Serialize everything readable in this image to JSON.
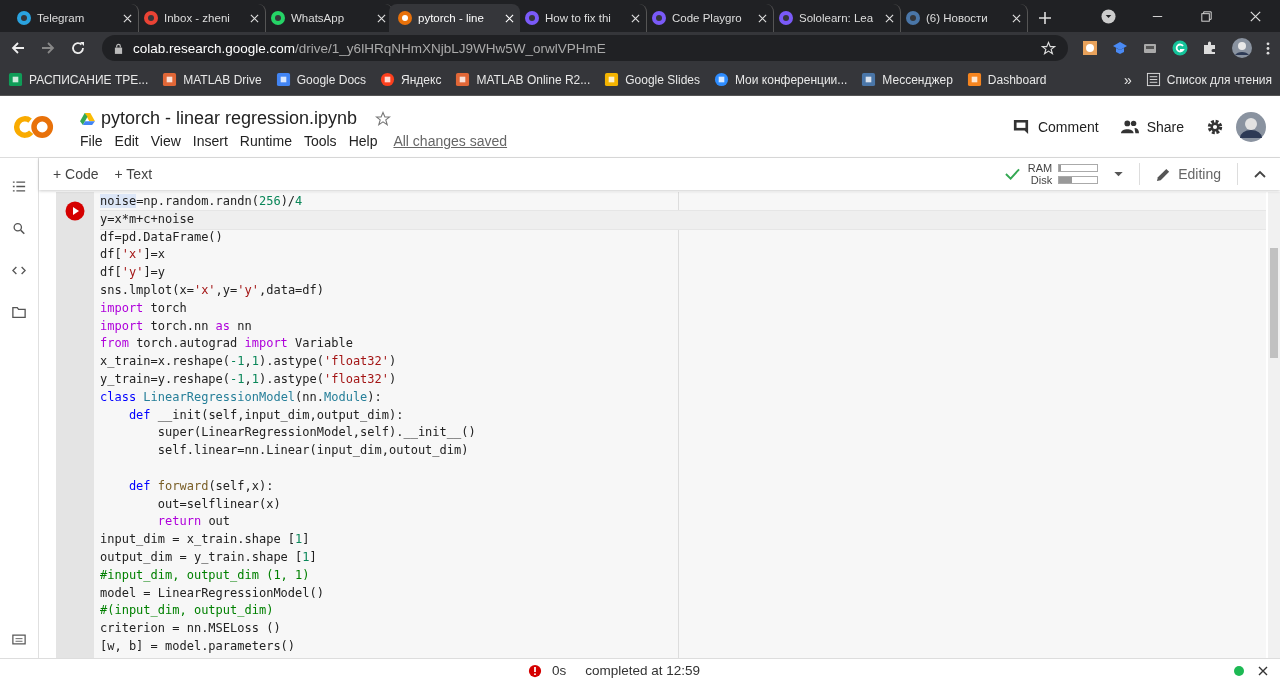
{
  "browser": {
    "tabs": [
      {
        "title": "Telegram",
        "selected": false
      },
      {
        "title": "Inbox - zheni",
        "selected": false
      },
      {
        "title": "WhatsApp",
        "selected": false
      },
      {
        "title": "pytorch - line",
        "selected": true
      },
      {
        "title": "How to fix thi",
        "selected": false
      },
      {
        "title": "Code Playgro",
        "selected": false
      },
      {
        "title": "Sololearn: Lea",
        "selected": false
      },
      {
        "title": "(6) Новости",
        "selected": false
      }
    ],
    "url_host": "colab.research.google.com",
    "url_path": "/drive/1_y6lHRqNHmXNjbLJ9WHw5W_orwlVPHmE",
    "bookmarks": [
      {
        "label": "РАСПИСАНИЕ ТРЕ..."
      },
      {
        "label": "MATLAB Drive"
      },
      {
        "label": "Google Docs"
      },
      {
        "label": "Яндекс"
      },
      {
        "label": "MATLAB Online R2..."
      },
      {
        "label": "Google Slides"
      },
      {
        "label": "Мои конференции..."
      },
      {
        "label": "Мессенджер"
      },
      {
        "label": "Dashboard"
      }
    ],
    "more": "»",
    "reading_list": "Список для чтения"
  },
  "notebook": {
    "title": "pytorch - linear regression.ipynb",
    "menu": [
      "File",
      "Edit",
      "View",
      "Insert",
      "Runtime",
      "Tools",
      "Help"
    ],
    "save_status": "All changes saved",
    "comment": "Comment",
    "share": "Share",
    "add_code": "+ Code",
    "add_text": "+ Text",
    "ram_label": "RAM",
    "ram": {
      "level": 0.05
    },
    "disk_label": "Disk",
    "disk": {
      "level": 0.35
    },
    "mode": "Editing"
  },
  "cell": {
    "lines": [
      {
        "current": false,
        "tokens": [
          {
            "kind": "match",
            "text": "noise"
          },
          {
            "kind": "plain",
            "text": "=np.random.randn("
          },
          {
            "kind": "num",
            "text": "256"
          },
          {
            "kind": "plain",
            "text": ")/"
          },
          {
            "kind": "num",
            "text": "4"
          }
        ]
      },
      {
        "current": true,
        "tokens": [
          {
            "kind": "plain",
            "text": "y=x*m+c+noise"
          }
        ]
      },
      {
        "current": false,
        "tokens": [
          {
            "kind": "plain",
            "text": "df=pd.DataFrame()"
          }
        ]
      },
      {
        "current": false,
        "tokens": [
          {
            "kind": "plain",
            "text": "df["
          },
          {
            "kind": "str",
            "text": "'x'"
          },
          {
            "kind": "plain",
            "text": "]=x"
          }
        ]
      },
      {
        "current": false,
        "tokens": [
          {
            "kind": "plain",
            "text": "df["
          },
          {
            "kind": "str",
            "text": "'y'"
          },
          {
            "kind": "plain",
            "text": "]=y"
          }
        ]
      },
      {
        "current": false,
        "tokens": [
          {
            "kind": "plain",
            "text": "sns.lmplot(x="
          },
          {
            "kind": "str",
            "text": "'x'"
          },
          {
            "kind": "plain",
            "text": ",y="
          },
          {
            "kind": "str",
            "text": "'y'"
          },
          {
            "kind": "plain",
            "text": ",data=df)"
          }
        ]
      },
      {
        "current": false,
        "tokens": [
          {
            "kind": "kw",
            "text": "import"
          },
          {
            "kind": "plain",
            "text": " torch"
          }
        ]
      },
      {
        "current": false,
        "tokens": [
          {
            "kind": "kw",
            "text": "import"
          },
          {
            "kind": "plain",
            "text": " torch.nn "
          },
          {
            "kind": "kw",
            "text": "as"
          },
          {
            "kind": "plain",
            "text": " nn"
          }
        ]
      },
      {
        "current": false,
        "tokens": [
          {
            "kind": "kw",
            "text": "from"
          },
          {
            "kind": "plain",
            "text": " torch.autograd "
          },
          {
            "kind": "kw",
            "text": "import"
          },
          {
            "kind": "plain",
            "text": " Variable"
          }
        ]
      },
      {
        "current": false,
        "tokens": [
          {
            "kind": "plain",
            "text": "x_train=x.reshape("
          },
          {
            "kind": "num",
            "text": "-1"
          },
          {
            "kind": "plain",
            "text": ","
          },
          {
            "kind": "num",
            "text": "1"
          },
          {
            "kind": "plain",
            "text": ").astype("
          },
          {
            "kind": "str",
            "text": "'float32'"
          },
          {
            "kind": "plain",
            "text": ")"
          }
        ]
      },
      {
        "current": false,
        "tokens": [
          {
            "kind": "plain",
            "text": "y_train=y.reshape("
          },
          {
            "kind": "num",
            "text": "-1"
          },
          {
            "kind": "plain",
            "text": ","
          },
          {
            "kind": "num",
            "text": "1"
          },
          {
            "kind": "plain",
            "text": ").astype("
          },
          {
            "kind": "str",
            "text": "'float32'"
          },
          {
            "kind": "plain",
            "text": ")"
          }
        ]
      },
      {
        "current": false,
        "tokens": [
          {
            "kind": "def",
            "text": "class "
          },
          {
            "kind": "type",
            "text": "LinearRegressionModel"
          },
          {
            "kind": "plain",
            "text": "(nn."
          },
          {
            "kind": "type",
            "text": "Module"
          },
          {
            "kind": "plain",
            "text": "):"
          }
        ]
      },
      {
        "current": false,
        "tokens": [
          {
            "kind": "def",
            "text": "    def"
          },
          {
            "kind": "plain",
            "text": " __init(self,input_dim,output_dim):"
          }
        ]
      },
      {
        "current": false,
        "tokens": [
          {
            "kind": "plain",
            "text": "        super(LinearRegressionModel,self).__init__()"
          }
        ]
      },
      {
        "current": false,
        "tokens": [
          {
            "kind": "plain",
            "text": "        self.linear=nn.Linear(input_dim,outout_dim)"
          }
        ]
      },
      {
        "current": false
      },
      {
        "current": false,
        "tokens": [
          {
            "kind": "def",
            "text": "    def "
          },
          {
            "kind": "fn",
            "text": "forward"
          },
          {
            "kind": "plain",
            "text": "(self,x):"
          }
        ]
      },
      {
        "current": false,
        "tokens": [
          {
            "kind": "plain",
            "text": "        out=selflinear(x)"
          }
        ]
      },
      {
        "current": false,
        "tokens": [
          {
            "kind": "kw",
            "text": "        return"
          },
          {
            "kind": "plain",
            "text": " out"
          }
        ]
      },
      {
        "current": false,
        "tokens": [
          {
            "kind": "plain",
            "text": "input_dim = x_train.shape ["
          },
          {
            "kind": "num",
            "text": "1"
          },
          {
            "kind": "plain",
            "text": "]"
          }
        ]
      },
      {
        "current": false,
        "tokens": [
          {
            "kind": "plain",
            "text": "output_dim = y_train.shape ["
          },
          {
            "kind": "num",
            "text": "1"
          },
          {
            "kind": "plain",
            "text": "]"
          }
        ]
      },
      {
        "current": false,
        "tokens": [
          {
            "kind": "cm",
            "text": "#input_dim, output_dim (1, 1)"
          }
        ]
      },
      {
        "current": false,
        "tokens": [
          {
            "kind": "plain",
            "text": "model = LinearRegressionModel()"
          }
        ]
      },
      {
        "current": false,
        "tokens": [
          {
            "kind": "cm",
            "text": "#(input_dim, output_dim)"
          }
        ]
      },
      {
        "current": false,
        "tokens": [
          {
            "kind": "plain",
            "text": "criterion = nn.MSELoss ()"
          }
        ]
      },
      {
        "current": false,
        "tokens": [
          {
            "kind": "plain",
            "text": "[w, b] = model.parameters()"
          }
        ]
      }
    ]
  },
  "status_bar": {
    "duration": "0s",
    "message": "completed at 12:59",
    "connected": true
  }
}
